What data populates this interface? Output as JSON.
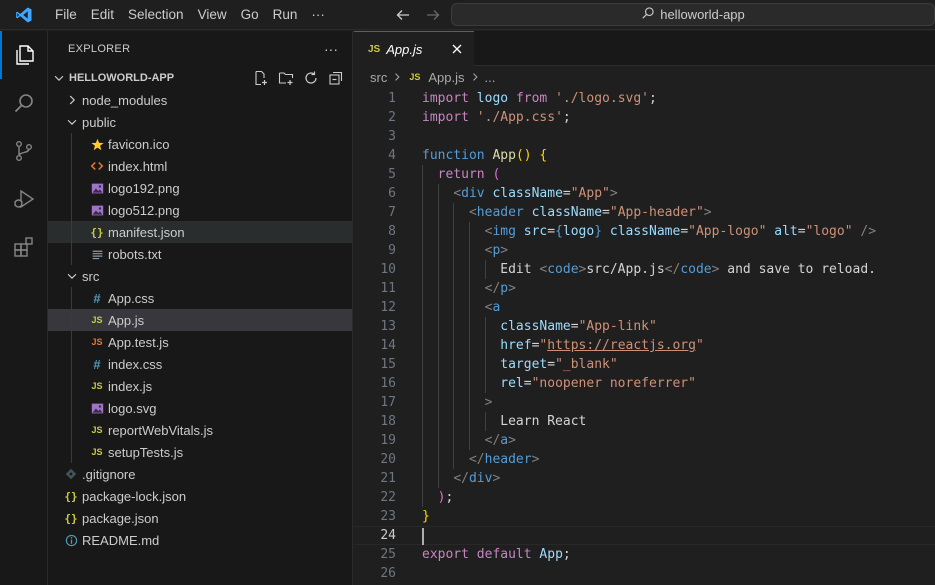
{
  "titlebar": {
    "menu": [
      "File",
      "Edit",
      "Selection",
      "View",
      "Go",
      "Run",
      "···"
    ],
    "search_text": "helloworld-app"
  },
  "explorer": {
    "title": "EXPLORER",
    "more": "···",
    "project": "HELLOWORLD-APP",
    "items": [
      {
        "label": "node_modules",
        "kind": "folder-closed",
        "depth": 1
      },
      {
        "label": "public",
        "kind": "folder-open",
        "depth": 1
      },
      {
        "label": "favicon.ico",
        "kind": "star",
        "depth": 2
      },
      {
        "label": "index.html",
        "kind": "html",
        "depth": 2
      },
      {
        "label": "logo192.png",
        "kind": "image",
        "depth": 2
      },
      {
        "label": "logo512.png",
        "kind": "image",
        "depth": 2
      },
      {
        "label": "manifest.json",
        "kind": "json",
        "depth": 2
      },
      {
        "label": "robots.txt",
        "kind": "text",
        "depth": 2
      },
      {
        "label": "src",
        "kind": "folder-open",
        "depth": 1
      },
      {
        "label": "App.css",
        "kind": "css",
        "depth": 2
      },
      {
        "label": "App.js",
        "kind": "js",
        "depth": 2
      },
      {
        "label": "App.test.js",
        "kind": "test",
        "depth": 2
      },
      {
        "label": "index.css",
        "kind": "css",
        "depth": 2
      },
      {
        "label": "index.js",
        "kind": "js",
        "depth": 2
      },
      {
        "label": "logo.svg",
        "kind": "svg",
        "depth": 2
      },
      {
        "label": "reportWebVitals.js",
        "kind": "js",
        "depth": 2
      },
      {
        "label": "setupTests.js",
        "kind": "js",
        "depth": 2
      },
      {
        "label": ".gitignore",
        "kind": "git",
        "depth": 1
      },
      {
        "label": "package-lock.json",
        "kind": "json",
        "depth": 1
      },
      {
        "label": "package.json",
        "kind": "json",
        "depth": 1
      },
      {
        "label": "README.md",
        "kind": "info",
        "depth": 1
      }
    ],
    "selected_label": "App.js",
    "hovered_label": "manifest.json"
  },
  "editor": {
    "tab_icon": "JS",
    "tab_label": "App.js",
    "breadcrumb": [
      "src",
      "App.js",
      "..."
    ],
    "current_line": 24,
    "lines": [
      [
        [
          "import",
          "k"
        ],
        [
          " logo ",
          "v"
        ],
        [
          "from",
          "k"
        ],
        [
          " ",
          "p"
        ],
        [
          "'./logo.svg'",
          "s"
        ],
        [
          ";",
          "p"
        ]
      ],
      [
        [
          "import",
          "k"
        ],
        [
          " ",
          "p"
        ],
        [
          "'./App.css'",
          "s"
        ],
        [
          ";",
          "p"
        ]
      ],
      [],
      [
        [
          "function",
          "kw"
        ],
        [
          " ",
          "p"
        ],
        [
          "App",
          "fn"
        ],
        [
          "()",
          "b1"
        ],
        [
          " ",
          "p"
        ],
        [
          "{",
          "b1"
        ]
      ],
      [
        [
          "  ",
          "p"
        ],
        [
          "return",
          "k"
        ],
        [
          " ",
          "p"
        ],
        [
          "(",
          "b2"
        ]
      ],
      [
        [
          "    ",
          "p"
        ],
        [
          "<",
          "tg"
        ],
        [
          "div",
          "t"
        ],
        [
          " ",
          "p"
        ],
        [
          "className",
          "a"
        ],
        [
          "=",
          "p"
        ],
        [
          "\"App\"",
          "s"
        ],
        [
          ">",
          "tg"
        ]
      ],
      [
        [
          "      ",
          "p"
        ],
        [
          "<",
          "tg"
        ],
        [
          "header",
          "t"
        ],
        [
          " ",
          "p"
        ],
        [
          "className",
          "a"
        ],
        [
          "=",
          "p"
        ],
        [
          "\"App-header\"",
          "s"
        ],
        [
          ">",
          "tg"
        ]
      ],
      [
        [
          "        ",
          "p"
        ],
        [
          "<",
          "tg"
        ],
        [
          "img",
          "t"
        ],
        [
          " ",
          "p"
        ],
        [
          "src",
          "a"
        ],
        [
          "=",
          "p"
        ],
        [
          "{",
          "kw"
        ],
        [
          "logo",
          "v"
        ],
        [
          "}",
          "kw"
        ],
        [
          " ",
          "p"
        ],
        [
          "className",
          "a"
        ],
        [
          "=",
          "p"
        ],
        [
          "\"App-logo\"",
          "s"
        ],
        [
          " ",
          "p"
        ],
        [
          "alt",
          "a"
        ],
        [
          "=",
          "p"
        ],
        [
          "\"logo\"",
          "s"
        ],
        [
          " ",
          "p"
        ],
        [
          "/>",
          "tg"
        ]
      ],
      [
        [
          "        ",
          "p"
        ],
        [
          "<",
          "tg"
        ],
        [
          "p",
          "t"
        ],
        [
          ">",
          "tg"
        ]
      ],
      [
        [
          "          Edit ",
          "p"
        ],
        [
          "<",
          "tg"
        ],
        [
          "code",
          "t"
        ],
        [
          ">",
          "tg"
        ],
        [
          "src/App.js",
          "p"
        ],
        [
          "</",
          "tg"
        ],
        [
          "code",
          "t"
        ],
        [
          ">",
          "tg"
        ],
        [
          " and save to reload.",
          "p"
        ]
      ],
      [
        [
          "        ",
          "p"
        ],
        [
          "</",
          "tg"
        ],
        [
          "p",
          "t"
        ],
        [
          ">",
          "tg"
        ]
      ],
      [
        [
          "        ",
          "p"
        ],
        [
          "<",
          "tg"
        ],
        [
          "a",
          "t"
        ]
      ],
      [
        [
          "          ",
          "p"
        ],
        [
          "className",
          "a"
        ],
        [
          "=",
          "p"
        ],
        [
          "\"App-link\"",
          "s"
        ]
      ],
      [
        [
          "          ",
          "p"
        ],
        [
          "href",
          "a"
        ],
        [
          "=",
          "p"
        ],
        [
          "\"",
          "s"
        ],
        [
          "https://reactjs.org",
          "su"
        ],
        [
          "\"",
          "s"
        ]
      ],
      [
        [
          "          ",
          "p"
        ],
        [
          "target",
          "a"
        ],
        [
          "=",
          "p"
        ],
        [
          "\"_blank\"",
          "s"
        ]
      ],
      [
        [
          "          ",
          "p"
        ],
        [
          "rel",
          "a"
        ],
        [
          "=",
          "p"
        ],
        [
          "\"noopener noreferrer\"",
          "s"
        ]
      ],
      [
        [
          "        ",
          "p"
        ],
        [
          ">",
          "tg"
        ]
      ],
      [
        [
          "          Learn React",
          "p"
        ]
      ],
      [
        [
          "        ",
          "p"
        ],
        [
          "</",
          "tg"
        ],
        [
          "a",
          "t"
        ],
        [
          ">",
          "tg"
        ]
      ],
      [
        [
          "      ",
          "p"
        ],
        [
          "</",
          "tg"
        ],
        [
          "header",
          "t"
        ],
        [
          ">",
          "tg"
        ]
      ],
      [
        [
          "    ",
          "p"
        ],
        [
          "</",
          "tg"
        ],
        [
          "div",
          "t"
        ],
        [
          ">",
          "tg"
        ]
      ],
      [
        [
          "  ",
          "p"
        ],
        [
          ")",
          "b2"
        ],
        [
          ";",
          "p"
        ]
      ],
      [
        [
          "}",
          "b1"
        ]
      ],
      [],
      [
        [
          "export",
          "k"
        ],
        [
          " ",
          "p"
        ],
        [
          "default",
          "k"
        ],
        [
          " ",
          "p"
        ],
        [
          "App",
          "v"
        ],
        [
          ";",
          "p"
        ]
      ],
      []
    ]
  }
}
